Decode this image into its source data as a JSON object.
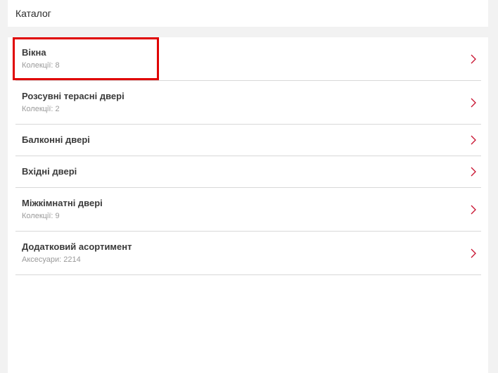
{
  "header": {
    "title": "Каталог"
  },
  "catalog": {
    "items": [
      {
        "title": "Вікна",
        "subtitle": "Колекції: 8"
      },
      {
        "title": "Розсувні терасні двері",
        "subtitle": "Колекції: 2"
      },
      {
        "title": "Балконні двері"
      },
      {
        "title": "Вхідні двері"
      },
      {
        "title": "Міжкімнатні двері",
        "subtitle": "Колекції: 9"
      },
      {
        "title": "Додатковий асортимент",
        "subtitle": "Аксесуари: 2214"
      }
    ]
  },
  "colors": {
    "accent": "#c8102e",
    "highlight": "#e00000",
    "background": "#f2f2f2",
    "panel": "#ffffff"
  },
  "icons": {
    "chevron": "chevron-right-icon"
  }
}
